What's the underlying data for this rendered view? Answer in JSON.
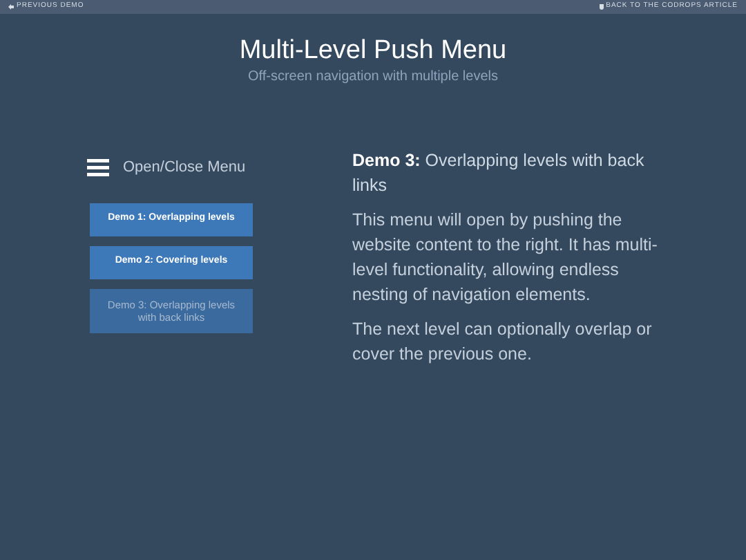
{
  "top_bar": {
    "previous_link": "PREVIOUS DEMO",
    "article_link": "BACK TO THE CODROPS ARTICLE"
  },
  "header": {
    "title": "Multi-Level Push Menu",
    "subtitle": "Off-screen navigation with multiple levels"
  },
  "menu_trigger": {
    "label": "Open/Close Menu"
  },
  "demo_buttons": [
    {
      "label": "Demo 1: Overlapping levels",
      "selected": false
    },
    {
      "label": "Demo 2: Covering levels",
      "selected": false
    },
    {
      "label": "Demo 3: Overlapping levels with back links",
      "selected": true
    }
  ],
  "content": {
    "heading": "**Demo 3:** Overlapping levels with back links",
    "paragraphs": [
      "This menu will open by pushing the website content to the right. It has multi-level functionality, allowing endless nesting of navigation elements.",
      "The next level can optionally overlap or cover the previous one."
    ]
  }
}
